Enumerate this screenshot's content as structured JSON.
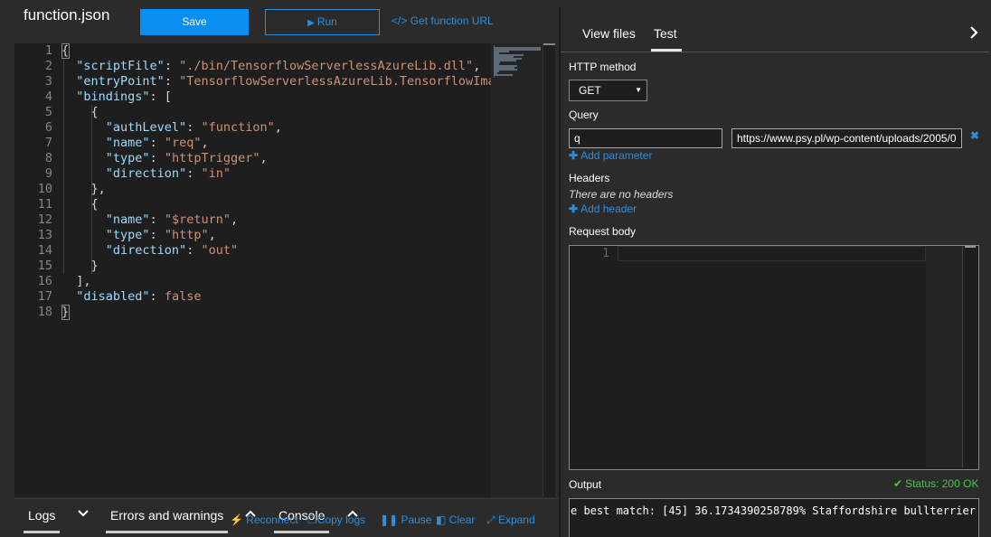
{
  "header": {
    "file_title": "function.json",
    "save_label": "Save",
    "run_label": "Run",
    "get_url_label": "</> Get function URL"
  },
  "editor": {
    "line_numbers": [
      "1",
      "2",
      "3",
      "4",
      "5",
      "6",
      "7",
      "8",
      "9",
      "10",
      "11",
      "12",
      "13",
      "14",
      "15",
      "16",
      "17",
      "18"
    ],
    "lines": [
      [
        {
          "t": "p",
          "v": "{"
        }
      ],
      [
        {
          "t": "p",
          "v": "  "
        },
        {
          "t": "k",
          "v": "\"scriptFile\""
        },
        {
          "t": "p",
          "v": ": "
        },
        {
          "t": "s",
          "v": "\"./bin/TensorflowServerlessAzureLib.dll\""
        },
        {
          "t": "p",
          "v": ","
        }
      ],
      [
        {
          "t": "p",
          "v": "  "
        },
        {
          "t": "k",
          "v": "\"entryPoint\""
        },
        {
          "t": "p",
          "v": ": "
        },
        {
          "t": "s",
          "v": "\"TensorflowServerlessAzureLib.TensorflowImage"
        }
      ],
      [
        {
          "t": "p",
          "v": "  "
        },
        {
          "t": "k",
          "v": "\"bindings\""
        },
        {
          "t": "p",
          "v": ": ["
        }
      ],
      [
        {
          "t": "p",
          "v": "    {"
        }
      ],
      [
        {
          "t": "p",
          "v": "      "
        },
        {
          "t": "k",
          "v": "\"authLevel\""
        },
        {
          "t": "p",
          "v": ": "
        },
        {
          "t": "s",
          "v": "\"function\""
        },
        {
          "t": "p",
          "v": ","
        }
      ],
      [
        {
          "t": "p",
          "v": "      "
        },
        {
          "t": "k",
          "v": "\"name\""
        },
        {
          "t": "p",
          "v": ": "
        },
        {
          "t": "s",
          "v": "\"req\""
        },
        {
          "t": "p",
          "v": ","
        }
      ],
      [
        {
          "t": "p",
          "v": "      "
        },
        {
          "t": "k",
          "v": "\"type\""
        },
        {
          "t": "p",
          "v": ": "
        },
        {
          "t": "s",
          "v": "\"httpTrigger\""
        },
        {
          "t": "p",
          "v": ","
        }
      ],
      [
        {
          "t": "p",
          "v": "      "
        },
        {
          "t": "k",
          "v": "\"direction\""
        },
        {
          "t": "p",
          "v": ": "
        },
        {
          "t": "s",
          "v": "\"in\""
        }
      ],
      [
        {
          "t": "p",
          "v": "    },"
        }
      ],
      [
        {
          "t": "p",
          "v": "    {"
        }
      ],
      [
        {
          "t": "p",
          "v": "      "
        },
        {
          "t": "k",
          "v": "\"name\""
        },
        {
          "t": "p",
          "v": ": "
        },
        {
          "t": "s",
          "v": "\"$return\""
        },
        {
          "t": "p",
          "v": ","
        }
      ],
      [
        {
          "t": "p",
          "v": "      "
        },
        {
          "t": "k",
          "v": "\"type\""
        },
        {
          "t": "p",
          "v": ": "
        },
        {
          "t": "s",
          "v": "\"http\""
        },
        {
          "t": "p",
          "v": ","
        }
      ],
      [
        {
          "t": "p",
          "v": "      "
        },
        {
          "t": "k",
          "v": "\"direction\""
        },
        {
          "t": "p",
          "v": ": "
        },
        {
          "t": "s",
          "v": "\"out\""
        }
      ],
      [
        {
          "t": "p",
          "v": "    }"
        }
      ],
      [
        {
          "t": "p",
          "v": "  ],"
        }
      ],
      [
        {
          "t": "p",
          "v": "  "
        },
        {
          "t": "k",
          "v": "\"disabled\""
        },
        {
          "t": "p",
          "v": ": "
        },
        {
          "t": "kw",
          "v": "false"
        }
      ],
      [
        {
          "t": "p",
          "v": "}"
        }
      ]
    ]
  },
  "bottom_tabs": {
    "logs": "Logs",
    "errors": "Errors and warnings",
    "console": "Console",
    "reconnect": "Reconnect",
    "copy_logs": "Copy logs",
    "pause": "Pause",
    "clear": "Clear",
    "expand": "Expand"
  },
  "right": {
    "tab_view_files": "View files",
    "tab_test": "Test",
    "http_method_label": "HTTP method",
    "http_method_value": "GET",
    "query_label": "Query",
    "query_name": "q",
    "query_value": "https://www.psy.pl/wp-content/uploads/2005/0",
    "add_parameter": "Add parameter",
    "headers_label": "Headers",
    "no_headers": "There are no headers",
    "add_header": "Add header",
    "request_body_label": "Request body",
    "body_line_number": "1",
    "output_label": "Output",
    "status": "Status: 200 OK",
    "output_text": "e best match: [45] 36.1734390258789% Staffordshire bullterrier"
  },
  "colors": {
    "accent": "#0a8ff0",
    "link": "#2b8fe0",
    "success": "#4cc44c",
    "editor_bg": "#1e1e1e",
    "panel_bg": "#2b2b2b"
  }
}
